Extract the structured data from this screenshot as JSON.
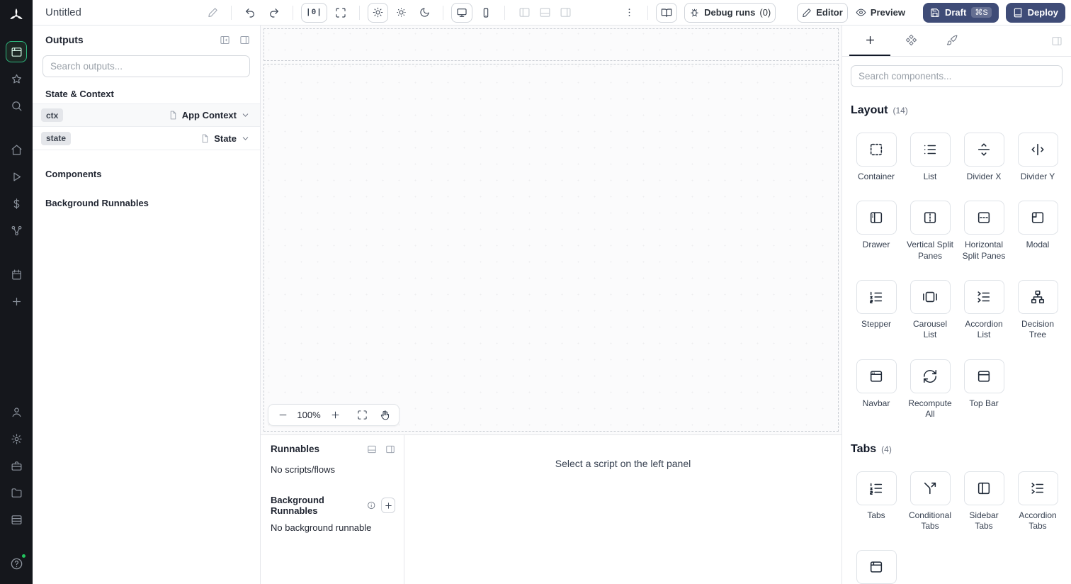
{
  "topbar": {
    "title": "Untitled",
    "width_marker": "|0|",
    "debug_runs_label": "Debug runs",
    "debug_runs_count": "(0)",
    "editor_label": "Editor",
    "preview_label": "Preview",
    "draft_label": "Draft",
    "draft_shortcut": "⌘S",
    "deploy_label": "Deploy"
  },
  "outputs_panel": {
    "title": "Outputs",
    "search_placeholder": "Search outputs...",
    "section_state_context": "State & Context",
    "section_components": "Components",
    "section_background": "Background Runnables",
    "rows": [
      {
        "badge": "ctx",
        "type": "App Context"
      },
      {
        "badge": "state",
        "type": "State"
      }
    ]
  },
  "canvas": {
    "zoom_level": "100%"
  },
  "runnables_panel": {
    "title": "Runnables",
    "empty_text": "No scripts/flows",
    "background_title": "Background Runnables",
    "background_empty_text": "No background runnable"
  },
  "script_panel": {
    "placeholder": "Select a script on the left panel"
  },
  "components_panel": {
    "search_placeholder": "Search components...",
    "layout_title": "Layout",
    "layout_count": "(14)",
    "tabs_title": "Tabs",
    "tabs_count": "(4)",
    "layout_items": [
      "Container",
      "List",
      "Divider X",
      "Divider Y",
      "Drawer",
      "Vertical Split Panes",
      "Horizontal Split Panes",
      "Modal",
      "Stepper",
      "Carousel List",
      "Accordion List",
      "Decision Tree",
      "Navbar",
      "Recompute All",
      "Top Bar"
    ],
    "tabs_items": [
      "Tabs",
      "Conditional Tabs",
      "Sidebar Tabs",
      "Accordion Tabs"
    ]
  },
  "colors": {
    "rail_background": "#15171c",
    "accent_green": "#2eb67d",
    "primary_button_navy": "#3f4c77",
    "border_gray": "#e5e7eb",
    "status_dot_green": "#22c55e"
  },
  "icons": {
    "windmill-logo": "pinwheel",
    "search-icon": "magnifier",
    "undo-icon": "curved-arrow-left",
    "redo-icon": "curved-arrow-right",
    "sun-icon": "sun",
    "moon-icon": "crescent",
    "monitor-icon": "desktop",
    "smartphone-icon": "phone",
    "kebab-icon": "vertical-dots",
    "book-icon": "open-book",
    "bug-icon": "bug",
    "pencil-icon": "pencil",
    "eye-icon": "eye",
    "plus-icon": "plus",
    "hand-icon": "grab-hand",
    "chevron-down-icon": "v"
  }
}
